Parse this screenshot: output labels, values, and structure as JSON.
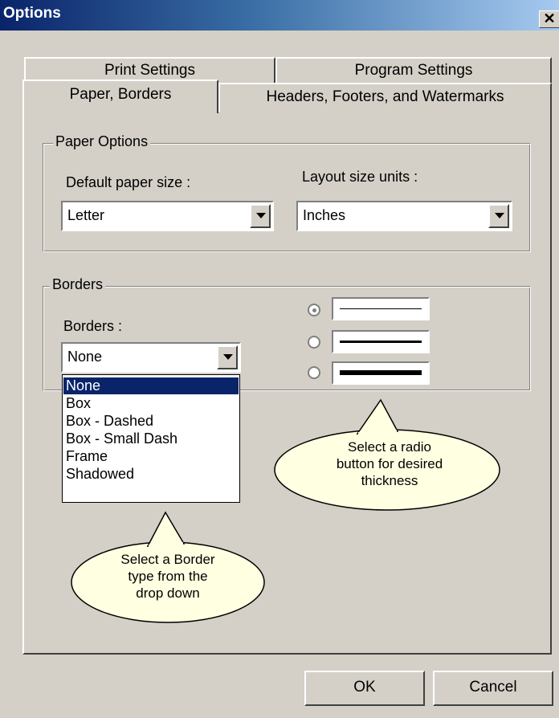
{
  "window": {
    "title": "Options",
    "close_glyph": "✕"
  },
  "tabs": {
    "back_row": [
      "Print Settings",
      "Program Settings"
    ],
    "front_row": [
      "Paper, Borders",
      "Headers, Footers, and Watermarks"
    ],
    "active": "Paper, Borders"
  },
  "paper_options": {
    "legend": "Paper Options",
    "default_paper_label": "Default paper size :",
    "default_paper_value": "Letter",
    "layout_units_label": "Layout size units :",
    "layout_units_value": "Inches"
  },
  "borders": {
    "legend": "Borders",
    "label": "Borders :",
    "selected_value": "None",
    "options": [
      "None",
      "Box",
      "Box - Dashed",
      "Box - Small Dash",
      "Frame",
      "Shadowed"
    ],
    "thickness_options": [
      "thin",
      "medium",
      "thick"
    ],
    "selected_thickness": "thin"
  },
  "callouts": {
    "radio": [
      "Select a radio",
      "button for desired",
      "thickness"
    ],
    "border": [
      "Select a Border",
      "type from the",
      "drop down"
    ]
  },
  "buttons": {
    "ok": "OK",
    "cancel": "Cancel"
  },
  "colors": {
    "dialog_bg": "#d4d0c8",
    "titlebar_start": "#0a246a",
    "titlebar_end": "#a6caf0",
    "selection": "#0a246a",
    "callout_fill": "#ffffe1"
  }
}
